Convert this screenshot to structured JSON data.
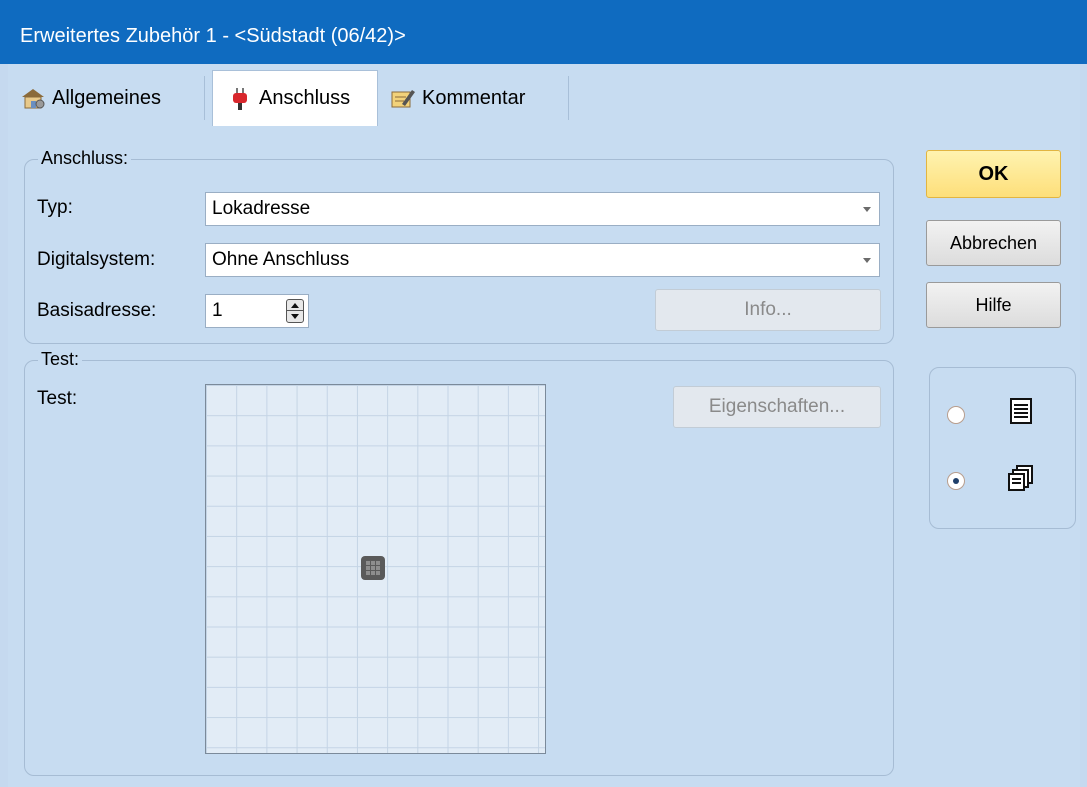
{
  "window": {
    "title": "Erweitertes Zubehör 1 - <Südstadt (06/42)>"
  },
  "tabs": [
    {
      "label": "Allgemeines",
      "icon": "house-settings-icon",
      "active": false
    },
    {
      "label": "Anschluss",
      "icon": "plug-icon",
      "active": true
    },
    {
      "label": "Kommentar",
      "icon": "note-pencil-icon",
      "active": false
    }
  ],
  "anschluss_group": {
    "title": "Anschluss:",
    "typ_label": "Typ:",
    "typ_value": "Lokadresse",
    "digitalsystem_label": "Digitalsystem:",
    "digitalsystem_value": "Ohne Anschluss",
    "basisadresse_label": "Basisadresse:",
    "basisadresse_value": "1",
    "info_button": "Info..."
  },
  "test_group": {
    "title": "Test:",
    "test_label": "Test:",
    "eigenschaften_button": "Eigenschaften..."
  },
  "side_buttons": {
    "ok": "OK",
    "cancel": "Abbrechen",
    "help": "Hilfe"
  },
  "view_options": [
    {
      "icon": "single-page-list-icon",
      "checked": false
    },
    {
      "icon": "multiple-pages-icon",
      "checked": true
    }
  ]
}
